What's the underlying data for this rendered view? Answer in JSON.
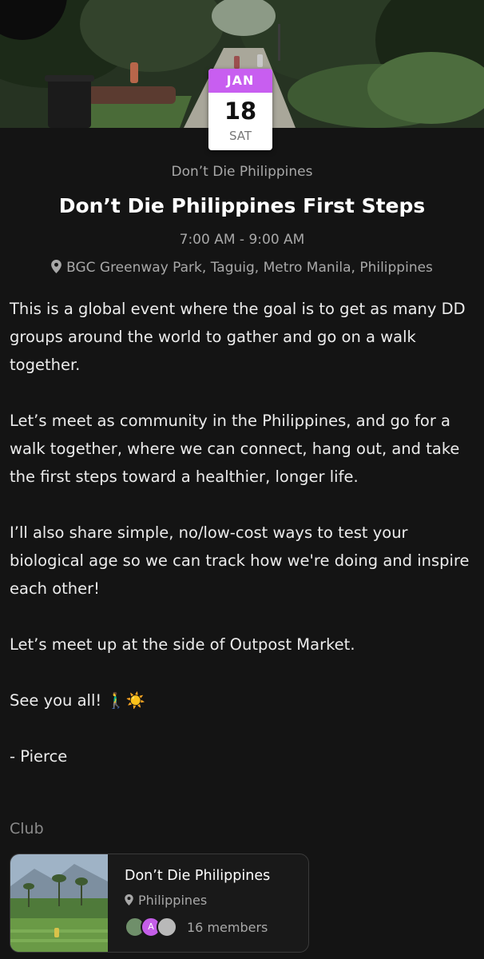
{
  "event": {
    "date": {
      "month": "JAN",
      "day": "18",
      "weekday": "SAT"
    },
    "organizer": "Don’t Die Philippines",
    "title": "Don’t Die Philippines First Steps",
    "time": "7:00 AM - 9:00 AM",
    "location": "BGC Greenway Park, Taguig, Metro Manila, Philippines",
    "description": [
      "This is a global event where the goal is to get as many DD groups around the world to gather and go on a walk together.",
      "Let’s meet as community in the Philippines, and go for a walk together, where we can connect, hang out, and take the first steps toward a healthier, longer life.",
      "I’ll also share simple, no/low-cost ways to test your biological age so we can track how we're doing and inspire each other!",
      "Let’s meet up at the side of Outpost Market.",
      "See you all! 🚶‍♂️☀️",
      "- Pierce"
    ]
  },
  "club_section": {
    "label": "Club",
    "club": {
      "name": "Don’t Die Philippines",
      "location": "Philippines",
      "avatar_letter": "A",
      "members": "16 members"
    }
  },
  "colors": {
    "background": "#141414",
    "accent_month": "#c85ef0",
    "muted_text": "#a8a8a8"
  },
  "icons": [
    "location-pin-icon"
  ]
}
